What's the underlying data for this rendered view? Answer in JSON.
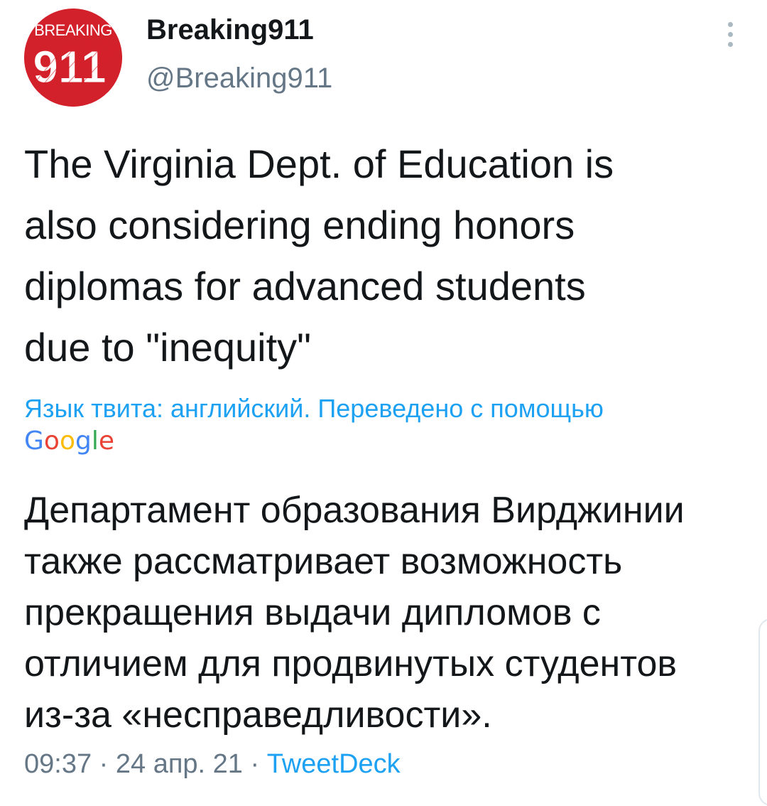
{
  "account": {
    "display_name": "Breaking911",
    "handle": "@Breaking911",
    "avatar_top_text": "BREAKING",
    "avatar_number": "911",
    "avatar_color": "#d3212b"
  },
  "menu": {
    "icon": "more-vertical-icon"
  },
  "tweet": {
    "text": "The Virginia Dept. of Education is\nalso considering ending honors\ndiplomas for advanced students\ndue to \"inequity\""
  },
  "translation": {
    "note": "Язык твита: английский. Переведено с помощью",
    "provider_letters": [
      "G",
      "o",
      "o",
      "g",
      "l",
      "e"
    ],
    "text": "Департамент образования Вирджинии\nтакже рассматривает возможность\nпрекращения выдачи дипломов с\nотличием для продвинутых студентов\nиз-за «несправедливости»."
  },
  "meta": {
    "time": "09:37",
    "date": "24 апр. 21",
    "separator": "·",
    "source": "TweetDeck"
  },
  "colors": {
    "text": "#14171a",
    "secondary": "#657786",
    "link": "#1da1f2"
  }
}
